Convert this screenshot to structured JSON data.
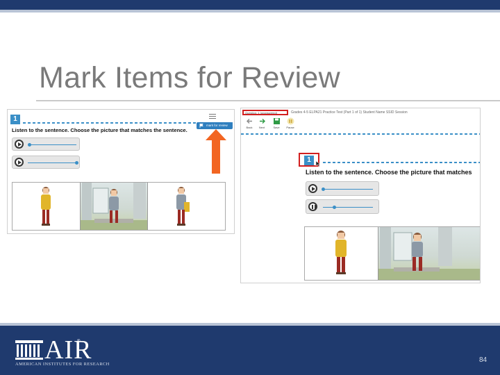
{
  "slide": {
    "title": "Mark Items for Review",
    "page_number": "84"
  },
  "left_screenshot": {
    "question_number": "1",
    "prompt": "Listen to the sentence. Choose the picture that matches the sentence.",
    "mark_for_review_label": "mark for review",
    "audio_1_progress": 0,
    "audio_2_progress": 0.9
  },
  "right_screenshot": {
    "question_select": "Question: 1 (unanswered)",
    "breadcrumb": "Grades 4-5 ELPA21 Practice Test (Part 1 of 1)  Student Name  SSID  Session",
    "toolbar": [
      {
        "label": "Back",
        "icon": "back-arrow-icon"
      },
      {
        "label": "Next",
        "icon": "next-arrow-icon"
      },
      {
        "label": "Save",
        "icon": "save-icon"
      },
      {
        "label": "Pause",
        "icon": "pause-icon"
      }
    ],
    "question_number": "1",
    "prompt": "Listen to the sentence. Choose the picture that matches",
    "audio_1_progress": 0,
    "audio_2_progress": 0.35
  },
  "footer": {
    "logo_text": "AIR",
    "logo_registered": "®",
    "organization": "AMERICAN INSTITUTES FOR RESEARCH"
  },
  "colors": {
    "navy": "#1f3a6e",
    "accent_blue": "#3a8fc7",
    "highlight_red": "#d21f1f",
    "arrow_orange": "#f26522"
  }
}
